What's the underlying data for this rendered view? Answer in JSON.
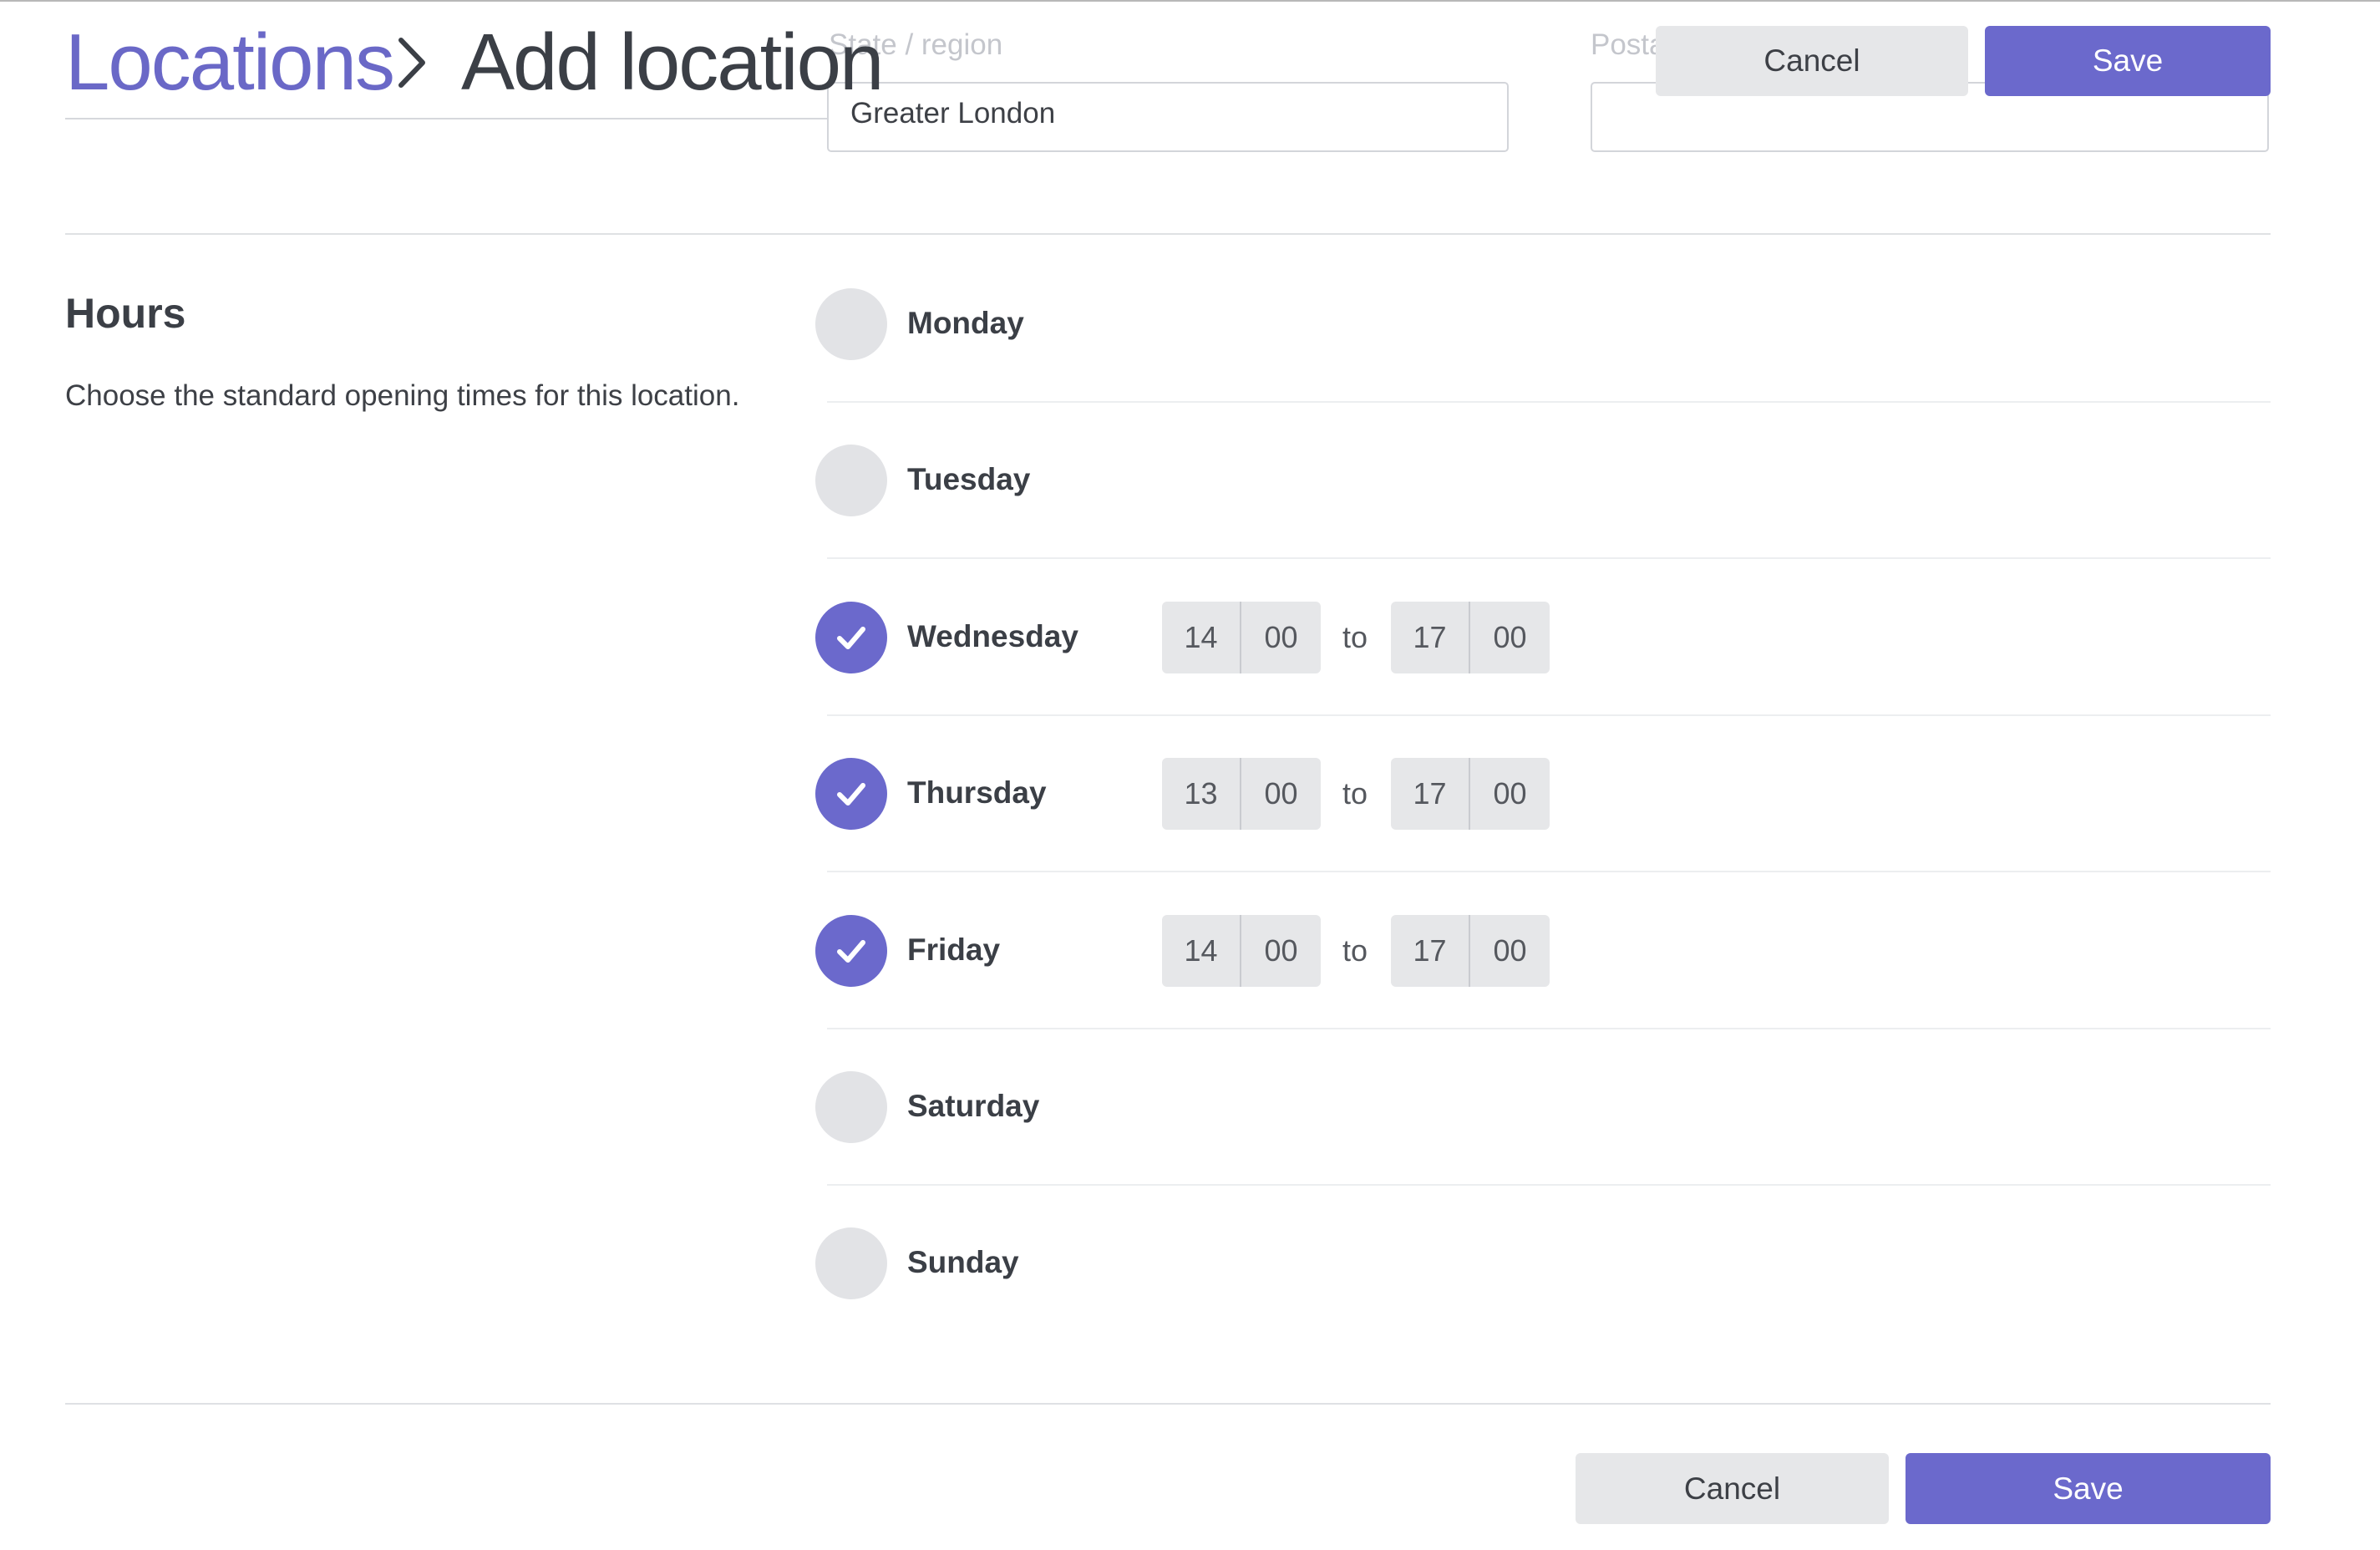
{
  "header": {
    "breadcrumb_parent": "Locations",
    "breadcrumb_current": "Add location",
    "cancel_label": "Cancel",
    "save_label": "Save"
  },
  "address": {
    "state_label": "State / region",
    "state_value": "Greater London",
    "postal_label": "Posta",
    "postal_value": ""
  },
  "hours": {
    "title": "Hours",
    "description": "Choose the standard opening times for this location.",
    "to_label": "to",
    "days": [
      {
        "name": "Monday",
        "enabled": false
      },
      {
        "name": "Tuesday",
        "enabled": false
      },
      {
        "name": "Wednesday",
        "enabled": true,
        "open_hour": "14",
        "open_minute": "00",
        "close_hour": "17",
        "close_minute": "00"
      },
      {
        "name": "Thursday",
        "enabled": true,
        "open_hour": "13",
        "open_minute": "00",
        "close_hour": "17",
        "close_minute": "00"
      },
      {
        "name": "Friday",
        "enabled": true,
        "open_hour": "14",
        "open_minute": "00",
        "close_hour": "17",
        "close_minute": "00"
      },
      {
        "name": "Saturday",
        "enabled": false
      },
      {
        "name": "Sunday",
        "enabled": false
      }
    ]
  },
  "footer": {
    "cancel_label": "Cancel",
    "save_label": "Save"
  },
  "colors": {
    "accent": "#6b69cc",
    "toggle_off": "#e2e3e6",
    "secondary_button": "#e6e7e9",
    "text": "#3d4046"
  },
  "icons": {
    "day_checked": "check-icon",
    "breadcrumb_separator": "chevron-right-icon"
  }
}
